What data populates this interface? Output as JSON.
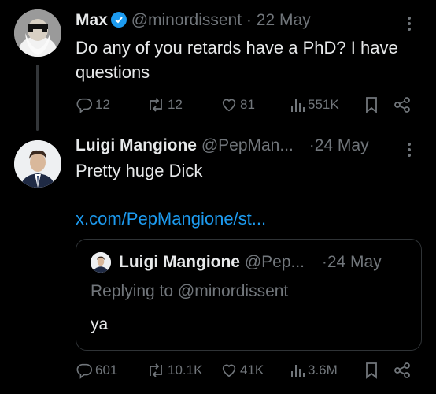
{
  "tweet1": {
    "name": "Max",
    "handle": "@minordissent",
    "sep": "·",
    "date": "22 May",
    "text": "Do any of you retards have a PhD? I have questions",
    "replies": "12",
    "reposts": "12",
    "likes": "81",
    "views": "551K"
  },
  "tweet2": {
    "name": "Luigi Mangione",
    "handle": "@PepMan...",
    "sep": "·",
    "date": "24 May",
    "text": "Pretty huge Dick",
    "link": "x.com/PepMangione/st...",
    "quote": {
      "name": "Luigi Mangione",
      "handle": "@Pep...",
      "sep": "·",
      "date": "24 May",
      "replying_to": "Replying to @minordissent",
      "text": "ya"
    },
    "replies": "601",
    "reposts": "10.1K",
    "likes": "41K",
    "views": "3.6M"
  },
  "colors": {
    "background": "#000000",
    "text": "#e7e9ea",
    "muted": "#71767b",
    "accent": "#1d9bf0",
    "border": "#2f3336"
  },
  "icons": [
    "verified-badge-icon",
    "more-icon",
    "reply-icon",
    "repost-icon",
    "like-icon",
    "views-icon",
    "bookmark-icon",
    "share-icon"
  ]
}
